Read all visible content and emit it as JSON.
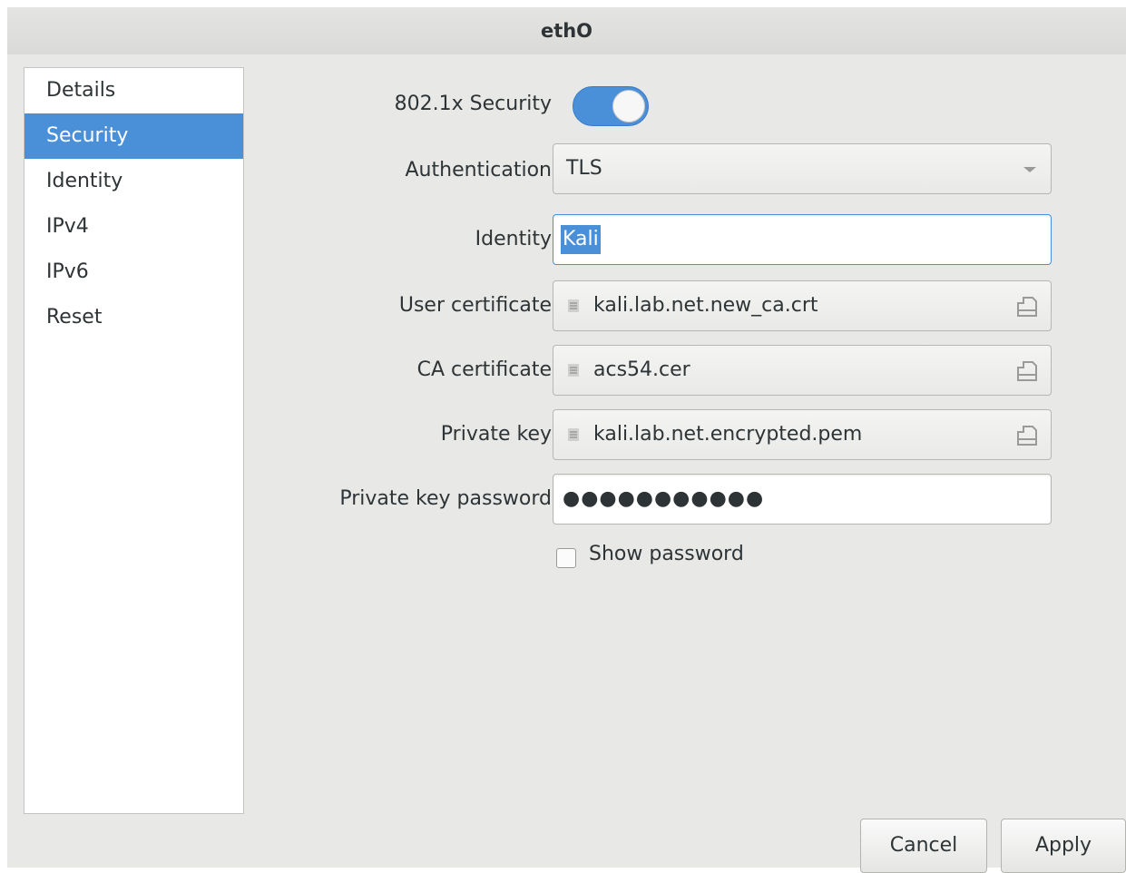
{
  "window": {
    "title": "ethO"
  },
  "sidebar": {
    "items": [
      {
        "label": "Details"
      },
      {
        "label": "Security",
        "selected": true
      },
      {
        "label": "Identity"
      },
      {
        "label": "IPv4"
      },
      {
        "label": "IPv6"
      },
      {
        "label": "Reset"
      }
    ]
  },
  "security": {
    "toggle_label": "802.1x Security",
    "toggle_on": true,
    "authentication_label": "Authentication",
    "authentication_value": "TLS",
    "identity_label": "Identity",
    "identity_value": "Kali",
    "user_cert_label": "User certificate",
    "user_cert_value": "kali.lab.net.new_ca.crt",
    "ca_cert_label": "CA certificate",
    "ca_cert_value": "acs54.cer",
    "private_key_label": "Private key",
    "private_key_value": "kali.lab.net.encrypted.pem",
    "private_key_password_label": "Private key password",
    "private_key_password_value": "●●●●●●●●●●●",
    "show_password_label": "Show password",
    "show_password_checked": false
  },
  "buttons": {
    "cancel": "Cancel",
    "apply": "Apply"
  },
  "colors": {
    "accent": "#4a90d9",
    "window_bg": "#e8e8e7"
  }
}
